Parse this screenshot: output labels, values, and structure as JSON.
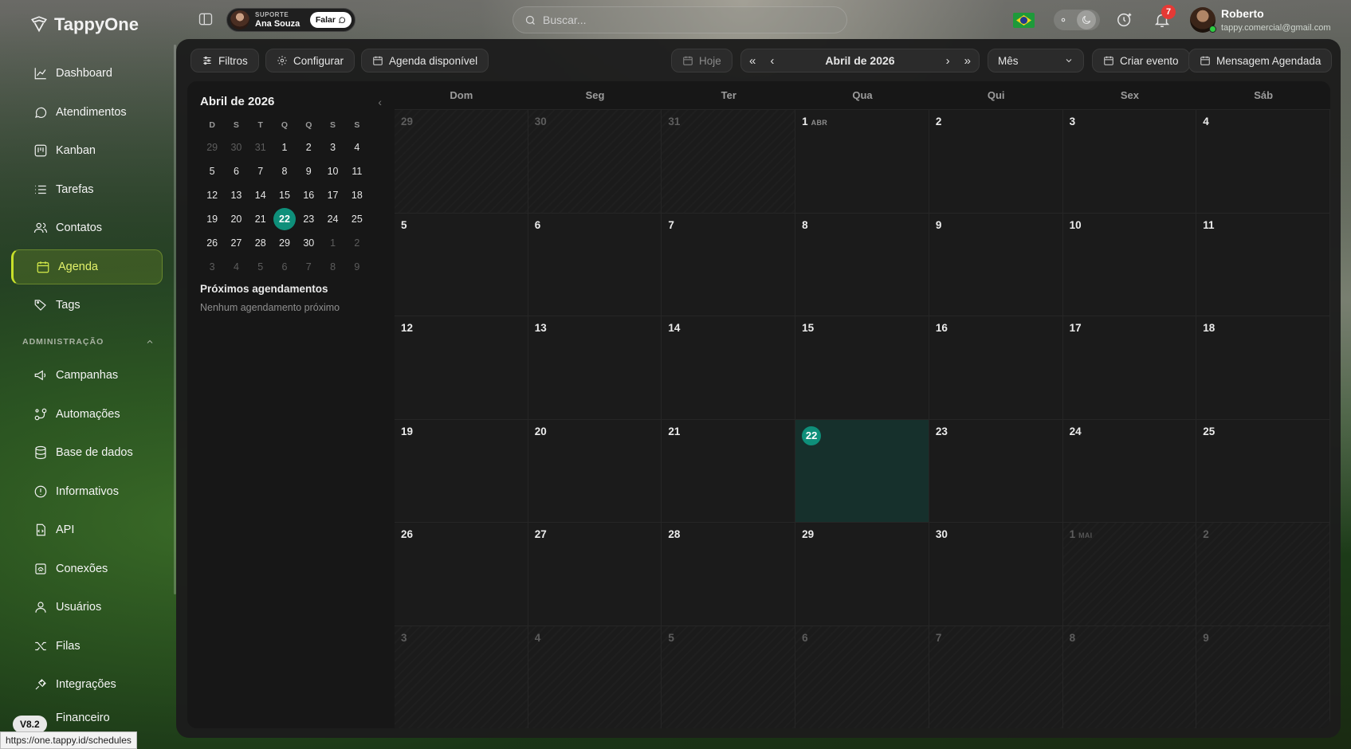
{
  "app": {
    "name": "TappyOne",
    "version": "V8.2",
    "status_url": "https://one.tappy.id/schedules"
  },
  "sidebar": {
    "items": [
      {
        "label": "Dashboard",
        "icon": "chart-line-icon"
      },
      {
        "label": "Atendimentos",
        "icon": "chat-icon"
      },
      {
        "label": "Kanban",
        "icon": "kanban-icon"
      },
      {
        "label": "Tarefas",
        "icon": "list-icon"
      },
      {
        "label": "Contatos",
        "icon": "users-icon"
      },
      {
        "label": "Agenda",
        "icon": "calendar-icon",
        "active": true
      },
      {
        "label": "Tags",
        "icon": "tag-icon"
      }
    ],
    "admin_label": "ADMINISTRAÇÃO",
    "admin_items": [
      {
        "label": "Campanhas",
        "icon": "megaphone-icon"
      },
      {
        "label": "Automações",
        "icon": "automation-icon"
      },
      {
        "label": "Base de dados",
        "icon": "database-icon"
      },
      {
        "label": "Informativos",
        "icon": "info-icon"
      },
      {
        "label": "API",
        "icon": "api-file-icon"
      },
      {
        "label": "Conexões",
        "icon": "connection-icon"
      },
      {
        "label": "Usuários",
        "icon": "user-icon"
      },
      {
        "label": "Filas",
        "icon": "queue-icon"
      },
      {
        "label": "Integrações",
        "icon": "plug-icon"
      },
      {
        "label": "Financeiro",
        "icon": "money-icon"
      }
    ]
  },
  "topbar": {
    "support_label": "SUPORTE",
    "support_name": "Ana Souza",
    "talk_label": "Falar",
    "search_placeholder": "Buscar...",
    "notifications_count": "7",
    "user_name": "Roberto",
    "user_email": "tappy.comercial@gmail.com"
  },
  "toolbar": {
    "filters": "Filtros",
    "configure": "Configurar",
    "availability": "Agenda disponível",
    "today": "Hoje",
    "month_title": "Abril de 2026",
    "view": "Mês",
    "create_event": "Criar evento",
    "scheduled_message": "Mensagem Agendada"
  },
  "mini_calendar": {
    "title": "Abril de 2026",
    "weekdays": [
      "D",
      "S",
      "T",
      "Q",
      "Q",
      "S",
      "S"
    ],
    "weeks": [
      [
        [
          "29",
          1
        ],
        [
          "30",
          1
        ],
        [
          "31",
          1
        ],
        [
          "1",
          0
        ],
        [
          "2",
          0
        ],
        [
          "3",
          0
        ],
        [
          "4",
          0
        ]
      ],
      [
        [
          "5",
          0
        ],
        [
          "6",
          0
        ],
        [
          "7",
          0
        ],
        [
          "8",
          0
        ],
        [
          "9",
          0
        ],
        [
          "10",
          0
        ],
        [
          "11",
          0
        ]
      ],
      [
        [
          "12",
          0
        ],
        [
          "13",
          0
        ],
        [
          "14",
          0
        ],
        [
          "15",
          0
        ],
        [
          "16",
          0
        ],
        [
          "17",
          0
        ],
        [
          "18",
          0
        ]
      ],
      [
        [
          "19",
          0
        ],
        [
          "20",
          0
        ],
        [
          "21",
          0
        ],
        [
          "22",
          2
        ],
        [
          "23",
          0
        ],
        [
          "24",
          0
        ],
        [
          "25",
          0
        ]
      ],
      [
        [
          "26",
          0
        ],
        [
          "27",
          0
        ],
        [
          "28",
          0
        ],
        [
          "29",
          0
        ],
        [
          "30",
          0
        ],
        [
          "1",
          1
        ],
        [
          "2",
          1
        ]
      ],
      [
        [
          "3",
          1
        ],
        [
          "4",
          1
        ],
        [
          "5",
          1
        ],
        [
          "6",
          1
        ],
        [
          "7",
          1
        ],
        [
          "8",
          1
        ],
        [
          "9",
          1
        ]
      ]
    ]
  },
  "upcoming": {
    "title": "Próximos agendamentos",
    "empty": "Nenhum agendamento próximo"
  },
  "calendar": {
    "weekdays": [
      "Dom",
      "Seg",
      "Ter",
      "Qua",
      "Qui",
      "Sex",
      "Sáb"
    ],
    "cells": [
      [
        "29",
        1,
        ""
      ],
      [
        "30",
        1,
        ""
      ],
      [
        "31",
        1,
        ""
      ],
      [
        "1",
        0,
        "ABR"
      ],
      [
        "2",
        0,
        ""
      ],
      [
        "3",
        0,
        ""
      ],
      [
        "4",
        0,
        ""
      ],
      [
        "5",
        0,
        ""
      ],
      [
        "6",
        0,
        ""
      ],
      [
        "7",
        0,
        ""
      ],
      [
        "8",
        0,
        ""
      ],
      [
        "9",
        0,
        ""
      ],
      [
        "10",
        0,
        ""
      ],
      [
        "11",
        0,
        ""
      ],
      [
        "12",
        0,
        ""
      ],
      [
        "13",
        0,
        ""
      ],
      [
        "14",
        0,
        ""
      ],
      [
        "15",
        0,
        ""
      ],
      [
        "16",
        0,
        ""
      ],
      [
        "17",
        0,
        ""
      ],
      [
        "18",
        0,
        ""
      ],
      [
        "19",
        0,
        ""
      ],
      [
        "20",
        0,
        ""
      ],
      [
        "21",
        0,
        ""
      ],
      [
        "22",
        2,
        ""
      ],
      [
        "23",
        0,
        ""
      ],
      [
        "24",
        0,
        ""
      ],
      [
        "25",
        0,
        ""
      ],
      [
        "26",
        0,
        ""
      ],
      [
        "27",
        0,
        ""
      ],
      [
        "28",
        0,
        ""
      ],
      [
        "29",
        0,
        ""
      ],
      [
        "30",
        0,
        ""
      ],
      [
        "1",
        1,
        "MAI"
      ],
      [
        "2",
        1,
        ""
      ],
      [
        "3",
        1,
        ""
      ],
      [
        "4",
        1,
        ""
      ],
      [
        "5",
        1,
        ""
      ],
      [
        "6",
        1,
        ""
      ],
      [
        "7",
        1,
        ""
      ],
      [
        "8",
        1,
        ""
      ],
      [
        "9",
        1,
        ""
      ]
    ]
  },
  "colors": {
    "accent": "#0e8f7a",
    "active_nav": "#c8e02a",
    "badge": "#e53935"
  }
}
